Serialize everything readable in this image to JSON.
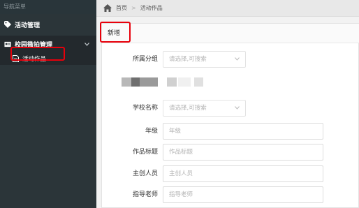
{
  "sidebar": {
    "header": "导航菜单",
    "groups": [
      {
        "label": "活动管理",
        "icon": "tag-icon"
      },
      {
        "label": "校园微拍管理",
        "icon": "id-card-icon",
        "children": [
          {
            "label": "活动作品",
            "icon": "document-icon"
          }
        ]
      }
    ]
  },
  "breadcrumb": {
    "home": "首页",
    "separator": ">",
    "current": "活动作品"
  },
  "panel": {
    "tab": "新增"
  },
  "form": {
    "category": {
      "label": "所属分组",
      "placeholder": "请选择,可搜索"
    },
    "school": {
      "label": "学校名称",
      "placeholder": "请选择,可搜索"
    },
    "grade": {
      "label": "年级",
      "placeholder": "年级"
    },
    "title": {
      "label": "作品标题",
      "placeholder": "作品标题"
    },
    "creator": {
      "label": "主创人员",
      "placeholder": "主创人员"
    },
    "advisor": {
      "label": "指导老师",
      "placeholder": "指导老师"
    }
  },
  "colors": {
    "sidebar_bg": "#2b3539",
    "highlight": "#e8000b"
  }
}
